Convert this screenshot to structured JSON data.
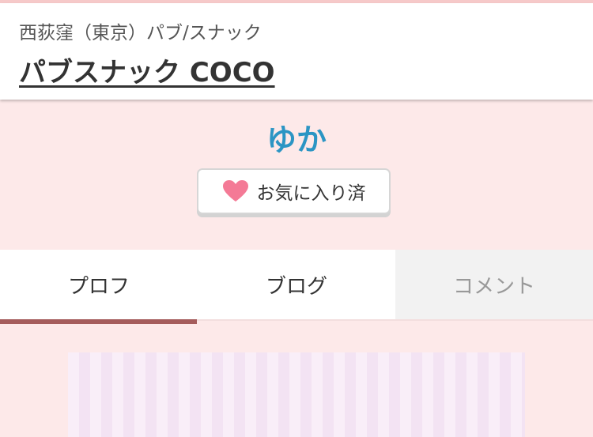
{
  "header": {
    "breadcrumb": "西荻窪（東京）パブ/スナック",
    "shop_name": "パブスナック COCO"
  },
  "profile": {
    "name": "ゆか",
    "favorite_button": {
      "label": "お気に入り済",
      "icon": "heart-icon",
      "icon_color": "#f47a96"
    }
  },
  "tabs": [
    {
      "label": "プロフ",
      "state": "active"
    },
    {
      "label": "ブログ",
      "state": "normal"
    },
    {
      "label": "コメント",
      "state": "muted"
    }
  ],
  "colors": {
    "page_background": "#fde9e9",
    "name_color": "#2b95c4",
    "tab_indicator": "#a55c5c"
  }
}
